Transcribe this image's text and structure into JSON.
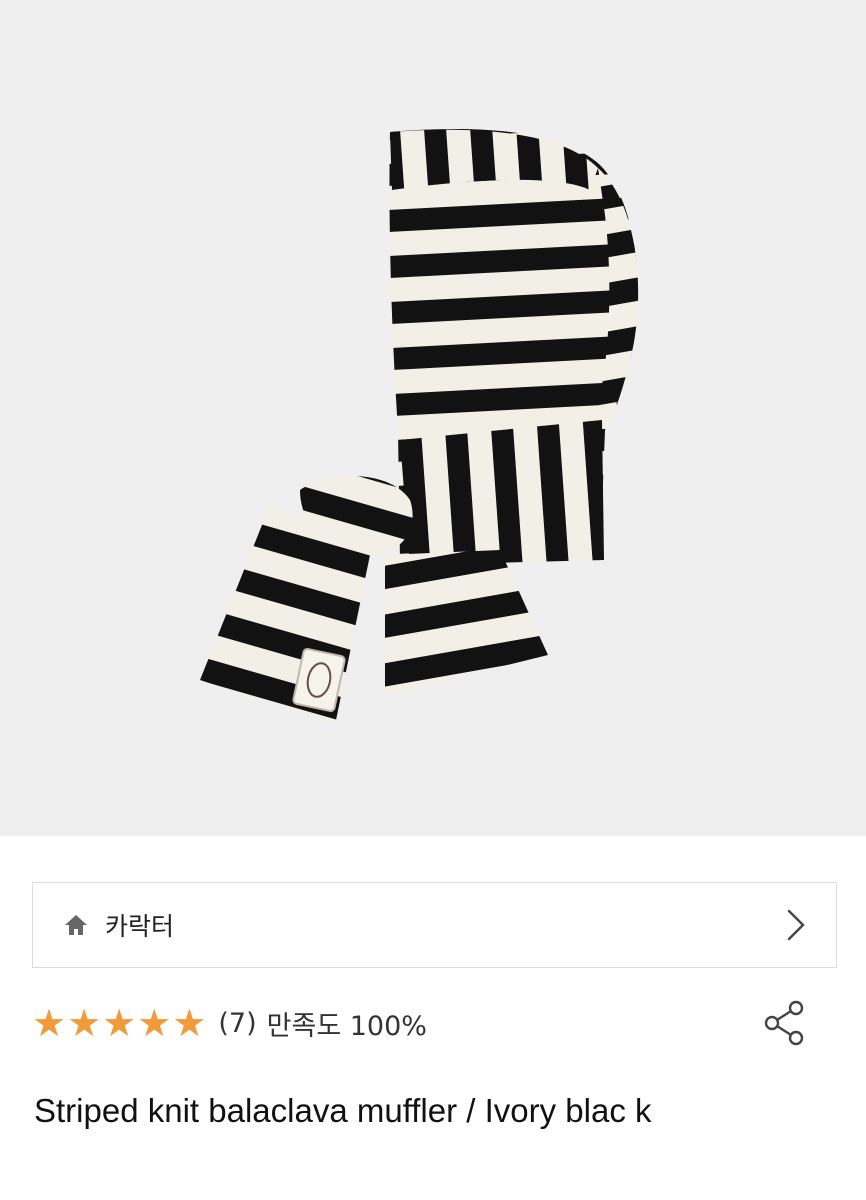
{
  "product": {
    "image_alt": "Striped knit balaclava muffler product photo",
    "title": "Striped knit balaclava muffler / Ivory blac k"
  },
  "brand": {
    "name": "카락터",
    "home_icon": "home-icon",
    "nav_icon": "chevron-right-icon"
  },
  "rating": {
    "stars": "★★★★★",
    "review_count": "(7)",
    "satisfaction": "만족도 100%",
    "star_color": "#f29a3a"
  },
  "actions": {
    "share_icon": "share-icon"
  }
}
